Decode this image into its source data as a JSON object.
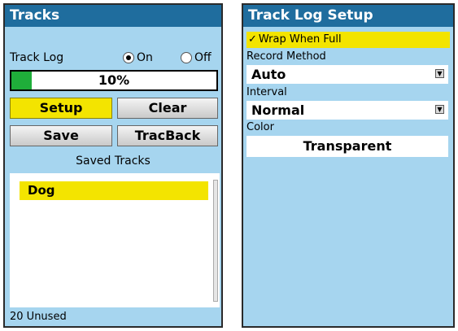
{
  "tracks_screen": {
    "title": "Tracks",
    "track_log_label": "Track Log",
    "on_label": "On",
    "off_label": "Off",
    "track_log_state": "on",
    "memory_percent": 10,
    "memory_percent_text": "10%",
    "buttons": {
      "setup": "Setup",
      "clear": "Clear",
      "save": "Save",
      "tracback": "TracBack"
    },
    "selected_button": "setup",
    "saved_tracks_heading": "Saved Tracks",
    "saved_tracks": [
      "Dog"
    ],
    "unused_text": "20 Unused"
  },
  "setup_screen": {
    "title": "Track Log Setup",
    "wrap_when_full_label": "Wrap When Full",
    "wrap_when_full_checked": true,
    "record_method_label": "Record Method",
    "record_method_value": "Auto",
    "interval_label": "Interval",
    "interval_value": "Normal",
    "color_label": "Color",
    "color_value": "Transparent"
  },
  "colors": {
    "screen_bg": "#a6d5ef",
    "title_bg": "#1f6d9e",
    "highlight": "#f3e400",
    "progress_fill": "#1fae3a"
  },
  "icons": {
    "checkmark": "check-icon",
    "dropdown": "dropdown-arrow-icon"
  }
}
